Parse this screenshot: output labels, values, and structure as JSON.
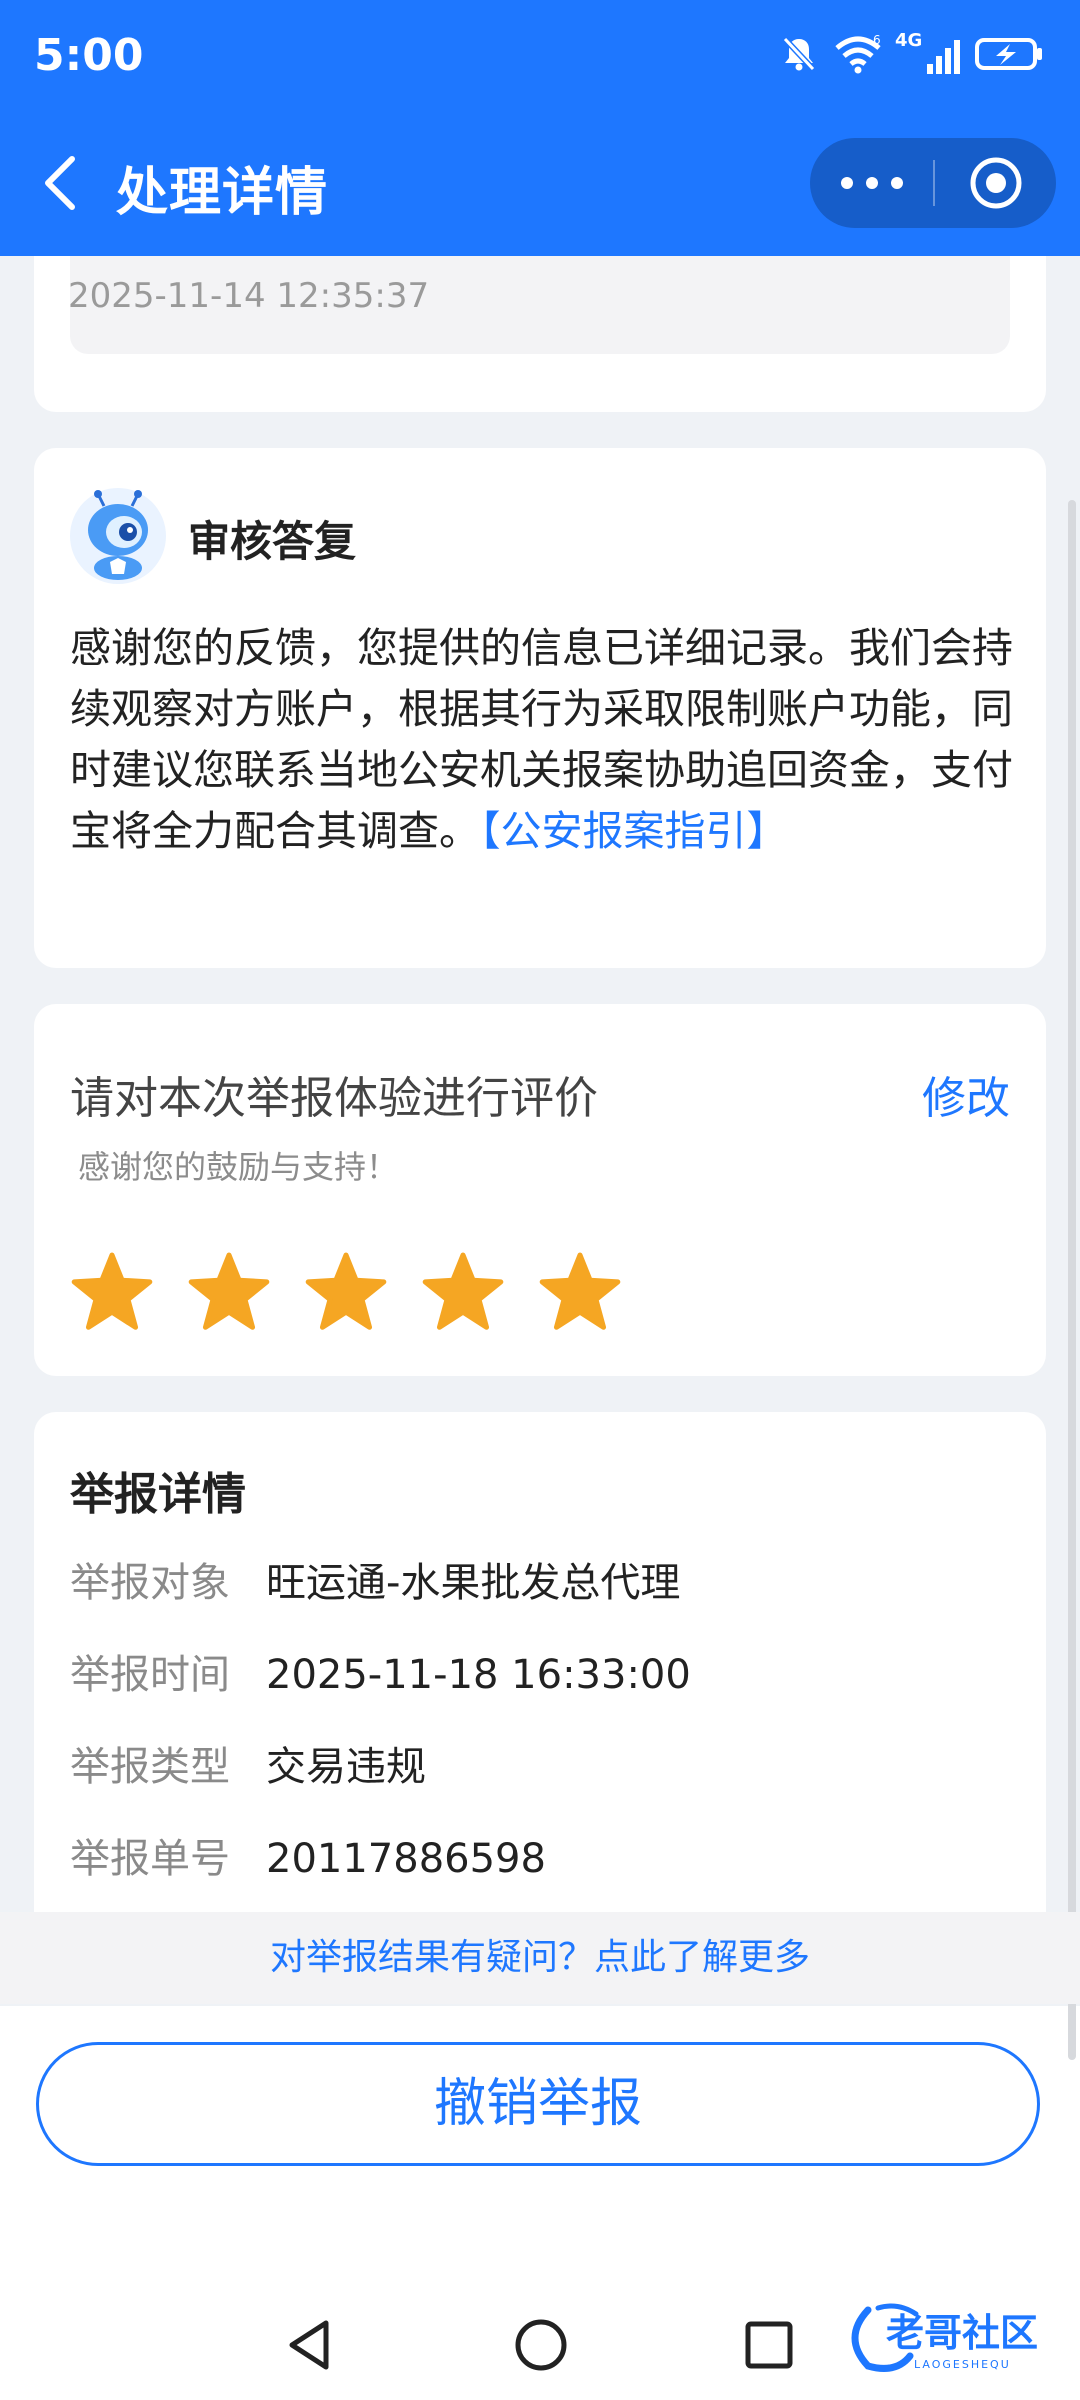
{
  "status_bar": {
    "time": "5:00",
    "network": "4G",
    "sim_index": "6"
  },
  "nav": {
    "title": "处理详情"
  },
  "timestamp_card": {
    "timestamp": "2025-11-14 12:35:37"
  },
  "reply_card": {
    "title": "审核答复",
    "body": "感谢您的反馈，您提供的信息已详细记录。我们会持续观察对方账户，根据其行为采取限制账户功能，同时建议您联系当地公安机关报案协助追回资金，支付宝将全力配合其调查。",
    "link": "【公安报案指引】"
  },
  "rating_card": {
    "question": "请对本次举报体验进行评价",
    "edit_label": "修改",
    "thanks": "感谢您的鼓励与支持！",
    "rating": 5,
    "max_rating": 5
  },
  "details_card": {
    "title": "举报详情",
    "rows": [
      {
        "label": "举报对象",
        "value": "旺运通-水果批发总代理"
      },
      {
        "label": "举报时间",
        "value": "2025-11-18 16:33:00"
      },
      {
        "label": "举报类型",
        "value": "交易违规"
      },
      {
        "label": "举报单号",
        "value": "20117886598"
      }
    ]
  },
  "question_link": "对举报结果有疑问？点此了解更多",
  "revoke_button": "撤销举报",
  "watermark": {
    "text": "老哥社区",
    "sub": "LAOGESHEQU"
  },
  "colors": {
    "primary": "#1e77ff",
    "star": "#f5a623",
    "background": "#eff2f6"
  }
}
